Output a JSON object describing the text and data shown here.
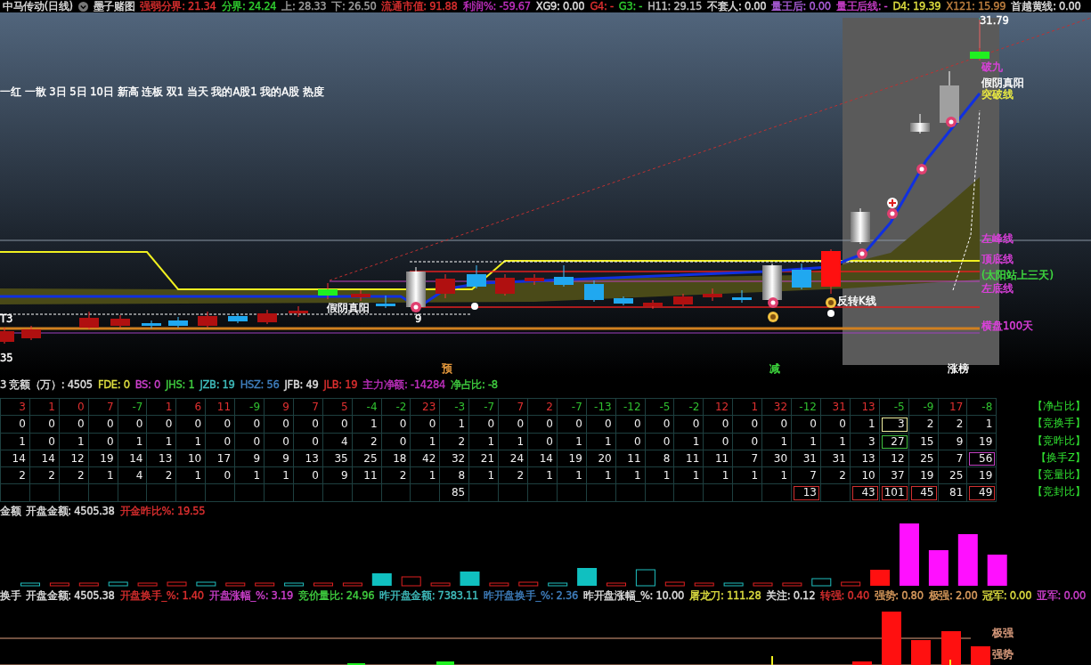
{
  "header": {
    "title": "中马传动(日线)",
    "formula": "墨子赌图",
    "indicators": [
      {
        "text": "强弱分界: 21.34",
        "color": "#e03030"
      },
      {
        "text": "分界: 24.24",
        "color": "#30d030"
      },
      {
        "text": "上: 28.33",
        "color": "#a0a0a0"
      },
      {
        "text": "下: 26.50",
        "color": "#a0a0a0"
      },
      {
        "text": "流通市值: 91.88",
        "color": "#e03030"
      },
      {
        "text": "利润%: -59.67",
        "color": "#c030c0"
      },
      {
        "text": "XG9: 0.00",
        "color": "#e0e0e0"
      },
      {
        "text": "G4: -",
        "color": "#e03030"
      },
      {
        "text": "G3: -",
        "color": "#30d030"
      },
      {
        "text": "H11: 29.15",
        "color": "#c0c0c0"
      },
      {
        "text": "不套人: 0.00",
        "color": "#e0e0e0"
      },
      {
        "text": "量王后: 0.00",
        "color": "#b060e0"
      },
      {
        "text": "量王后线: -",
        "color": "#d040d0"
      },
      {
        "text": "D4: 19.39",
        "color": "#e0e040"
      },
      {
        "text": "X121: 15.99",
        "color": "#c08040"
      },
      {
        "text": "首越黄线: 0.00",
        "color": "#e0e0e0"
      }
    ]
  },
  "chart_labels": [
    {
      "text": "31.79",
      "color": "#ffffff"
    },
    {
      "text": "破九",
      "color": "#e040e0"
    },
    {
      "text": "假阴真阳",
      "color": "#ffffff"
    },
    {
      "text": "突破线",
      "color": "#f0f040"
    },
    {
      "text": "左峰线",
      "color": "#e040e0"
    },
    {
      "text": "顶底线",
      "color": "#e040e0"
    },
    {
      "text": "(太阳站上三天)",
      "color": "#40e040"
    },
    {
      "text": "左底线",
      "color": "#e040e0"
    },
    {
      "text": "横盘100天",
      "color": "#e040e0"
    },
    {
      "text": "假阴真阳",
      "color": "#ffffff"
    },
    {
      "text": "9",
      "color": "#ffffff"
    },
    {
      "text": "反转K线",
      "color": "#ffffff"
    },
    {
      "text": "T3",
      "color": "#ffffff"
    },
    {
      "text": "35",
      "color": "#ffffff"
    },
    {
      "text": "预",
      "color": "#f0a040"
    },
    {
      "text": "减",
      "color": "#40e040"
    },
    {
      "text": "涨榜",
      "color": "#ffffff"
    },
    {
      "text": "一红 一散 3日 5日 10日 新高 连板 双1 当天 我的A股1 我的A股 热度",
      "color": "#ffffff"
    }
  ],
  "auction_panel": {
    "indicators": [
      {
        "text": "3 竞额（万）: 4505",
        "color": "#e0e0e0"
      },
      {
        "text": "FDE: 0",
        "color": "#e0e040"
      },
      {
        "text": "BS: 0",
        "color": "#d040d0"
      },
      {
        "text": "JHS: 1",
        "color": "#40d040"
      },
      {
        "text": "JZB: 19",
        "color": "#40c0c0"
      },
      {
        "text": "HSZ: 56",
        "color": "#4080c0"
      },
      {
        "text": "JFB: 49",
        "color": "#e0e0e0"
      },
      {
        "text": "JLB: 19",
        "color": "#e03030"
      },
      {
        "text": "主力净额: -14284",
        "color": "#c030c0"
      },
      {
        "text": "净占比: -8",
        "color": "#40d040"
      }
    ],
    "rows": [
      {
        "label": "【净占比】",
        "kind": "signed",
        "cells": [
          {
            "text": "3",
            "color": "#e03030"
          },
          {
            "text": "1",
            "color": "#e03030"
          },
          {
            "text": "0",
            "color": "#e03030"
          },
          {
            "text": "7",
            "color": "#e03030"
          },
          {
            "text": "-7",
            "color": "#30c030"
          },
          {
            "text": "1",
            "color": "#e03030"
          },
          {
            "text": "6",
            "color": "#e03030"
          },
          {
            "text": "11",
            "color": "#e03030"
          },
          {
            "text": "-9",
            "color": "#30c030"
          },
          {
            "text": "9",
            "color": "#e03030"
          },
          {
            "text": "7",
            "color": "#e03030"
          },
          {
            "text": "5",
            "color": "#e03030"
          },
          {
            "text": "-4",
            "color": "#30c030"
          },
          {
            "text": "-2",
            "color": "#30c030"
          },
          {
            "text": "23",
            "color": "#e03030"
          },
          {
            "text": "-3",
            "color": "#30c030"
          },
          {
            "text": "-7",
            "color": "#30c030"
          },
          {
            "text": "7",
            "color": "#e03030"
          },
          {
            "text": "2",
            "color": "#e03030"
          },
          {
            "text": "-7",
            "color": "#30c030"
          },
          {
            "text": "-13",
            "color": "#30c030"
          },
          {
            "text": "-12",
            "color": "#30c030"
          },
          {
            "text": "-5",
            "color": "#30c030"
          },
          {
            "text": "-2",
            "color": "#30c030"
          },
          {
            "text": "12",
            "color": "#e03030"
          },
          {
            "text": "1",
            "color": "#e03030"
          },
          {
            "text": "32",
            "color": "#e03030"
          },
          {
            "text": "-12",
            "color": "#30c030"
          },
          {
            "text": "31",
            "color": "#e03030"
          },
          {
            "text": "13",
            "color": "#e03030"
          },
          {
            "text": "-5",
            "color": "#30c030"
          },
          {
            "text": "-9",
            "color": "#30c030"
          },
          {
            "text": "17",
            "color": "#e03030"
          },
          {
            "text": "-8",
            "color": "#30c030"
          }
        ]
      },
      {
        "label": "【竞换手】",
        "kind": "plain",
        "cells": [
          {
            "text": "0"
          },
          {
            "text": "0"
          },
          {
            "text": "0"
          },
          {
            "text": "0"
          },
          {
            "text": "0"
          },
          {
            "text": "0"
          },
          {
            "text": "0"
          },
          {
            "text": "0"
          },
          {
            "text": "0"
          },
          {
            "text": "0"
          },
          {
            "text": "0"
          },
          {
            "text": "0"
          },
          {
            "text": "1"
          },
          {
            "text": "0"
          },
          {
            "text": "0"
          },
          {
            "text": "1"
          },
          {
            "text": "0"
          },
          {
            "text": "0"
          },
          {
            "text": "0"
          },
          {
            "text": "0"
          },
          {
            "text": "0"
          },
          {
            "text": "0"
          },
          {
            "text": "0"
          },
          {
            "text": "0"
          },
          {
            "text": "0"
          },
          {
            "text": "0"
          },
          {
            "text": "0"
          },
          {
            "text": "0"
          },
          {
            "text": "0"
          },
          {
            "text": "1"
          },
          {
            "text": "3",
            "color": "#f0f0a0"
          },
          {
            "text": "2"
          },
          {
            "text": "2"
          },
          {
            "text": "1"
          }
        ]
      },
      {
        "label": "【竞昨比】",
        "kind": "plain",
        "cells": [
          {
            "text": "1"
          },
          {
            "text": "0"
          },
          {
            "text": "1"
          },
          {
            "text": "0"
          },
          {
            "text": "1"
          },
          {
            "text": "1"
          },
          {
            "text": "1"
          },
          {
            "text": "0"
          },
          {
            "text": "0"
          },
          {
            "text": "0"
          },
          {
            "text": "0"
          },
          {
            "text": "4"
          },
          {
            "text": "2"
          },
          {
            "text": "0"
          },
          {
            "text": "1"
          },
          {
            "text": "2"
          },
          {
            "text": "1"
          },
          {
            "text": "1"
          },
          {
            "text": "0"
          },
          {
            "text": "1"
          },
          {
            "text": "1"
          },
          {
            "text": "0"
          },
          {
            "text": "0"
          },
          {
            "text": "1"
          },
          {
            "text": "0"
          },
          {
            "text": "0"
          },
          {
            "text": "1"
          },
          {
            "text": "1"
          },
          {
            "text": "1"
          },
          {
            "text": "3"
          },
          {
            "text": "27",
            "color": "#40c040"
          },
          {
            "text": "15"
          },
          {
            "text": "9"
          },
          {
            "text": "19"
          }
        ]
      },
      {
        "label": "【换手Z】",
        "kind": "plain",
        "cells": [
          {
            "text": "14"
          },
          {
            "text": "14"
          },
          {
            "text": "12"
          },
          {
            "text": "19"
          },
          {
            "text": "14"
          },
          {
            "text": "13"
          },
          {
            "text": "10"
          },
          {
            "text": "17"
          },
          {
            "text": "9"
          },
          {
            "text": "9"
          },
          {
            "text": "13"
          },
          {
            "text": "35"
          },
          {
            "text": "25"
          },
          {
            "text": "18"
          },
          {
            "text": "42"
          },
          {
            "text": "32"
          },
          {
            "text": "21"
          },
          {
            "text": "24"
          },
          {
            "text": "14"
          },
          {
            "text": "19"
          },
          {
            "text": "20"
          },
          {
            "text": "11"
          },
          {
            "text": "8"
          },
          {
            "text": "11"
          },
          {
            "text": "11"
          },
          {
            "text": "7"
          },
          {
            "text": "30"
          },
          {
            "text": "31"
          },
          {
            "text": "31"
          },
          {
            "text": "13"
          },
          {
            "text": "12"
          },
          {
            "text": "25"
          },
          {
            "text": "7"
          },
          {
            "text": "56",
            "color": "#c040c0"
          }
        ]
      },
      {
        "label": "【竞量比】",
        "kind": "plain",
        "cells": [
          {
            "text": "2"
          },
          {
            "text": "2"
          },
          {
            "text": "2"
          },
          {
            "text": "1"
          },
          {
            "text": "4"
          },
          {
            "text": "2"
          },
          {
            "text": "1"
          },
          {
            "text": "0"
          },
          {
            "text": "1"
          },
          {
            "text": "1"
          },
          {
            "text": "0"
          },
          {
            "text": "9"
          },
          {
            "text": "11"
          },
          {
            "text": "2"
          },
          {
            "text": "1"
          },
          {
            "text": "8"
          },
          {
            "text": "1"
          },
          {
            "text": "2"
          },
          {
            "text": "1"
          },
          {
            "text": "1"
          },
          {
            "text": "1"
          },
          {
            "text": "1"
          },
          {
            "text": "1"
          },
          {
            "text": "1"
          },
          {
            "text": "1"
          },
          {
            "text": "1"
          },
          {
            "text": "1"
          },
          {
            "text": "7"
          },
          {
            "text": "2"
          },
          {
            "text": "10"
          },
          {
            "text": "37"
          },
          {
            "text": "19"
          },
          {
            "text": "25"
          },
          {
            "text": "19"
          }
        ]
      },
      {
        "label": "【竞封比】",
        "kind": "plain",
        "cells": [
          null,
          null,
          null,
          null,
          null,
          null,
          null,
          null,
          null,
          null,
          null,
          null,
          null,
          null,
          null,
          {
            "text": "85"
          },
          null,
          null,
          null,
          null,
          null,
          null,
          null,
          null,
          null,
          null,
          null,
          {
            "text": "13",
            "color": "#d03030"
          },
          null,
          {
            "text": "43",
            "color": "#d03030"
          },
          {
            "text": "101",
            "color": "#d03030"
          },
          {
            "text": "45",
            "color": "#d03030"
          },
          {
            "text": "81"
          },
          {
            "text": "49",
            "color": "#d03030"
          }
        ]
      }
    ]
  },
  "open_amount_panel": {
    "indicators": [
      {
        "text": "金额",
        "color": "#e0e0e0"
      },
      {
        "text": "开盘金额: 4505.38",
        "color": "#e0e0e0"
      },
      {
        "text": "开金昨比%: 19.55",
        "color": "#e03030"
      }
    ]
  },
  "turnover_panel": {
    "indicators": [
      {
        "text": "换手",
        "color": "#e0e0e0"
      },
      {
        "text": "开盘金额: 4505.38",
        "color": "#e0e0e0"
      },
      {
        "text": "开盘换手_%: 1.40",
        "color": "#e03030"
      },
      {
        "text": "开盘涨幅_%: 3.19",
        "color": "#d040d0"
      },
      {
        "text": "竞价量比: 24.96",
        "color": "#40d040"
      },
      {
        "text": "昨开盘金额: 7383.11",
        "color": "#40c0c0"
      },
      {
        "text": "昨开盘换手_%: 2.36",
        "color": "#4080c0"
      },
      {
        "text": "昨开盘涨幅_%: 10.00",
        "color": "#e0e0e0"
      },
      {
        "text": "屠龙刀: 111.28",
        "color": "#e0e040"
      },
      {
        "text": "关注: 0.12",
        "color": "#e0e0e0"
      },
      {
        "text": "转强: 0.40",
        "color": "#e03030"
      },
      {
        "text": "强势: 0.80",
        "color": "#e0a060"
      },
      {
        "text": "极强: 2.00",
        "color": "#e0a060"
      },
      {
        "text": "冠军: 0.00",
        "color": "#e0e040"
      },
      {
        "text": "亚军: 0.00",
        "color": "#d040d0"
      }
    ],
    "levels": [
      {
        "text": "极强",
        "color": "#e0a080"
      },
      {
        "text": "强势",
        "color": "#e0a080"
      }
    ]
  }
}
